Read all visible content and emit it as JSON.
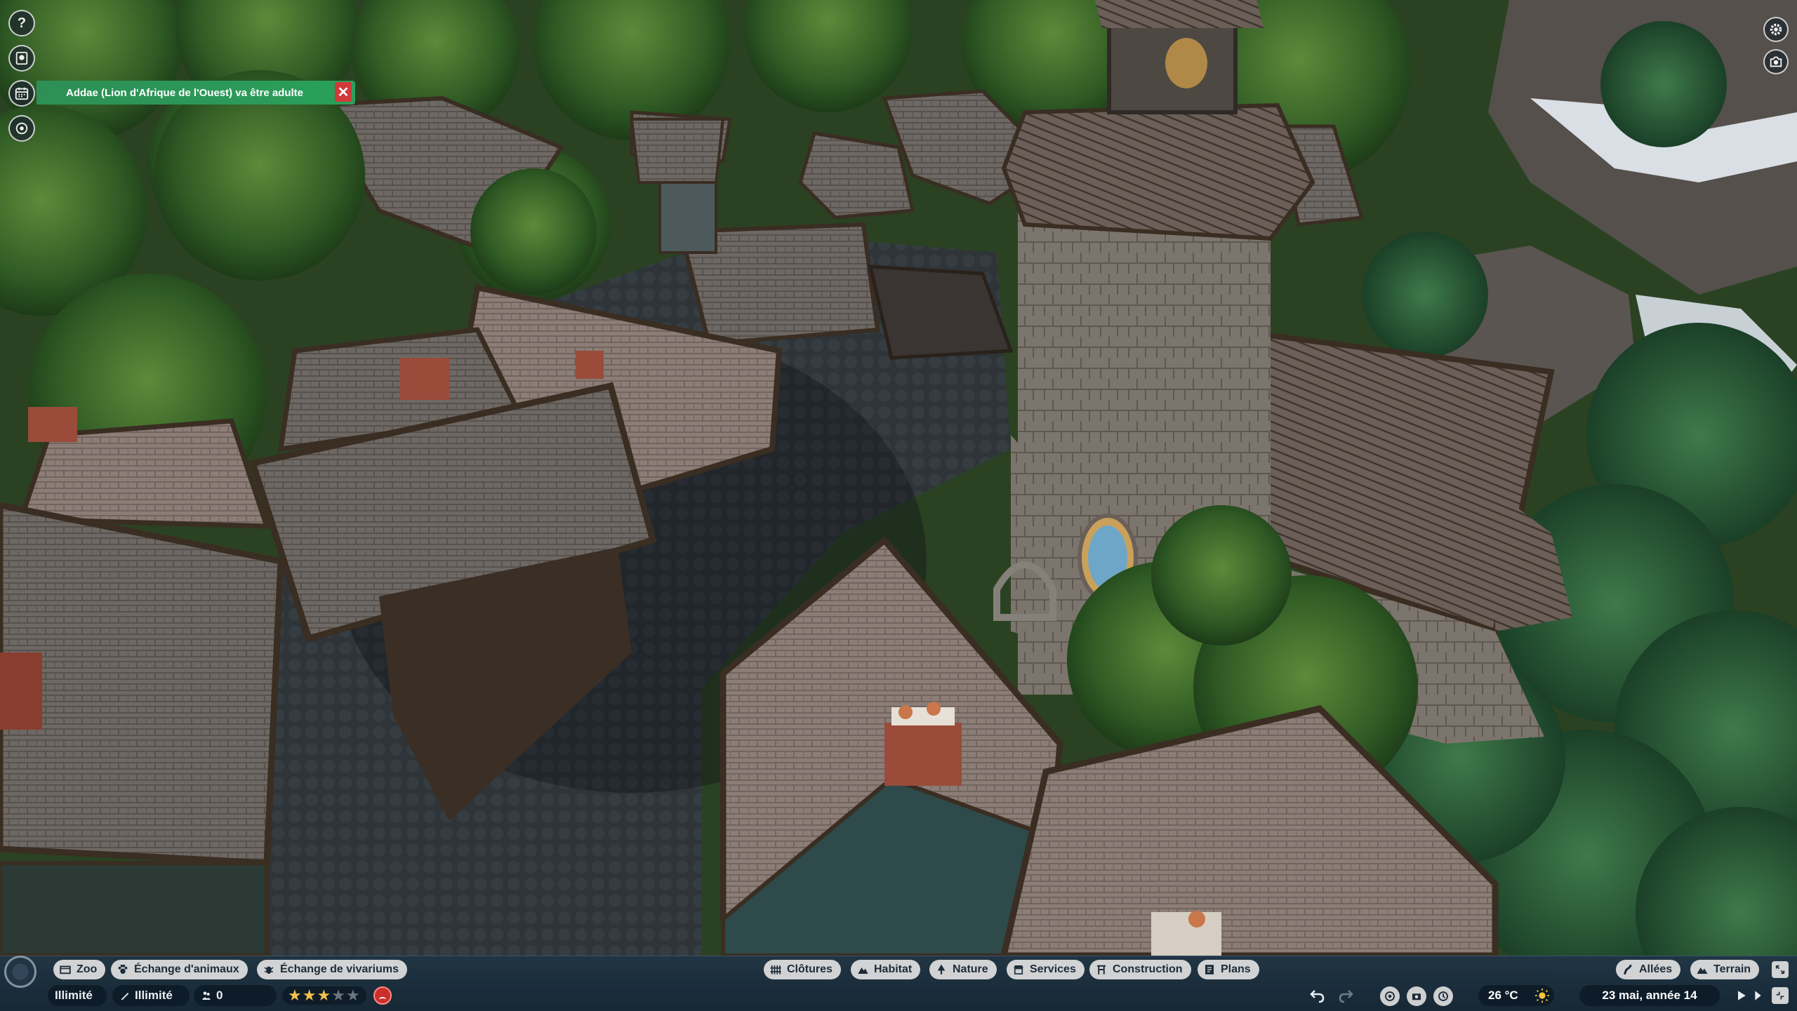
{
  "notification": {
    "message": "Addae (Lion d'Afrique de l'Ouest) va être adulte"
  },
  "left_hud": {
    "help_label": "?",
    "icons": [
      "help-icon",
      "zoopedia-icon",
      "calendar-icon",
      "overlay-eye-icon"
    ]
  },
  "right_hud": {
    "icons": [
      "settings-gear-icon",
      "camera-icon"
    ]
  },
  "bottom_bar": {
    "left_tabs": [
      {
        "label": "Zoo",
        "icon": "zoo-icon"
      },
      {
        "label": "Échange d'animaux",
        "icon": "paw-icon"
      },
      {
        "label": "Échange de vivariums",
        "icon": "bug-icon"
      }
    ],
    "center_tabs": [
      {
        "label": "Clôtures",
        "icon": "fence-icon"
      },
      {
        "label": "Habitat",
        "icon": "habitat-icon"
      },
      {
        "label": "Nature",
        "icon": "tree-icon"
      },
      {
        "label": "Services",
        "icon": "shop-icon"
      },
      {
        "label": "Construction",
        "icon": "construction-icon"
      },
      {
        "label": "Plans",
        "icon": "blueprint-icon"
      }
    ],
    "right_tabs": [
      {
        "label": "Allées",
        "icon": "path-icon"
      },
      {
        "label": "Terrain",
        "icon": "terrain-icon"
      }
    ],
    "stats": {
      "money": "Illimité",
      "research": "Illimité",
      "guests": "0"
    },
    "rating_stars": 3,
    "rating_max": 5,
    "temperature": "26 °C",
    "weather_icon": "sun-icon",
    "date": "23 mai, année 14"
  },
  "colors": {
    "notification_green": "#2a9a58",
    "close_red": "#d13a3a",
    "bar_blue": "#1c3246",
    "star_gold": "#f2c14e",
    "happiness_red": "#c9302c"
  }
}
